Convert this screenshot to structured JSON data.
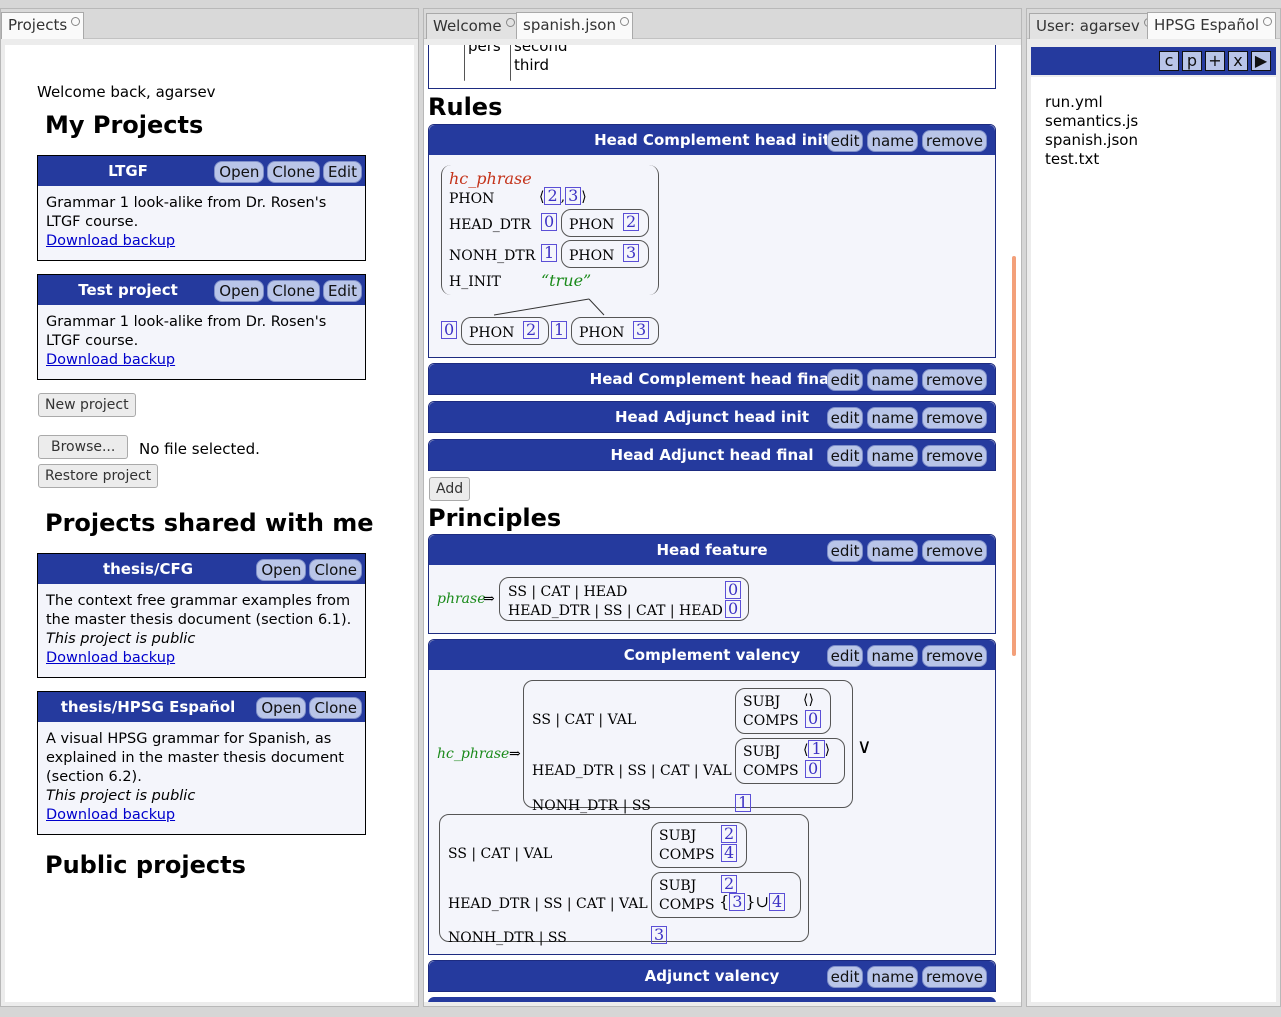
{
  "left_tab": "Projects",
  "welcome": "Welcome back, agarsev",
  "my_projects_heading": "My Projects",
  "my_projects": [
    {
      "title": "LTGF",
      "buttons": [
        "Open",
        "Clone",
        "Edit"
      ],
      "desc": "Grammar 1 look-alike from Dr. Rosen's LTGF course.",
      "link": "Download backup"
    },
    {
      "title": "Test project",
      "buttons": [
        "Open",
        "Clone",
        "Edit"
      ],
      "desc": "Grammar 1 look-alike from Dr. Rosen's LTGF course.",
      "link": "Download backup"
    }
  ],
  "new_project": "New project",
  "browse": "Browse...",
  "no_file": "No file selected.",
  "restore_project": "Restore project",
  "shared_heading": "Projects shared with me",
  "shared_projects": [
    {
      "title": "thesis/CFG",
      "buttons": [
        "Open",
        "Clone"
      ],
      "desc": "The context free grammar examples from the master thesis document (section 6.1).",
      "public": "This project is public",
      "link": "Download backup"
    },
    {
      "title": "thesis/HPSG Español",
      "buttons": [
        "Open",
        "Clone"
      ],
      "desc": "A visual HPSG grammar for Spanish, as explained in the master thesis document (section 6.2).",
      "public": "This project is public",
      "link": "Download backup"
    }
  ],
  "public_heading": "Public projects",
  "middle_tabs": [
    "Welcome",
    "spanish.json"
  ],
  "top_fragment": {
    "pers": "pers",
    "second": "second",
    "third": "third"
  },
  "rules_heading": "Rules",
  "box_buttons": [
    "edit",
    "name",
    "remove"
  ],
  "rules": [
    {
      "title": "Head Complement head init"
    },
    {
      "title": "Head Complement head final"
    },
    {
      "title": "Head Adjunct head init"
    },
    {
      "title": "Head Adjunct head final"
    }
  ],
  "hc_init": {
    "type": "hc_phrase",
    "phon": "PHON",
    "head_dtr": "HEAD_DTR",
    "nonh_dtr": "NONH_DTR",
    "h_init": "H_INIT",
    "true_val": "“true”",
    "t0": "0",
    "t1": "1",
    "t2": "2",
    "t3": "3"
  },
  "add": "Add",
  "principles_heading": "Principles",
  "principles": [
    {
      "title": "Head feature"
    },
    {
      "title": "Complement valency"
    },
    {
      "title": "Adjunct valency"
    }
  ],
  "head_feature": {
    "lhs": "phrase",
    "row1": "SS | CAT | HEAD",
    "row2": "HEAD_DTR | SS | CAT | HEAD",
    "tag": "0"
  },
  "comp_valency": {
    "lhs": "hc_phrase",
    "r1": "SS | CAT | VAL",
    "r2": "HEAD_DTR | SS | CAT | VAL",
    "r3": "NONH_DTR | SS",
    "subj": "SUBJ",
    "comps": "COMPS",
    "or": "∨",
    "t0": "0",
    "t1": "1",
    "t2": "2",
    "t3": "3",
    "t4": "4",
    "empty": "⟨⟩",
    "union": "}∪",
    "lbrace": "{"
  },
  "right_tabs": [
    "User: agarsev",
    "HPSG Español"
  ],
  "toolbar_buttons": [
    "c",
    "p",
    "+",
    "x",
    "▶"
  ],
  "files": [
    "run.yml",
    "semantics.js",
    "spanish.json",
    "test.txt"
  ],
  "colors": {
    "header_blue": "#253a9e",
    "btn_blue": "#b9c5e8",
    "tag_purple": "#3d32c4",
    "scroll_orange": "#f3a07a"
  }
}
